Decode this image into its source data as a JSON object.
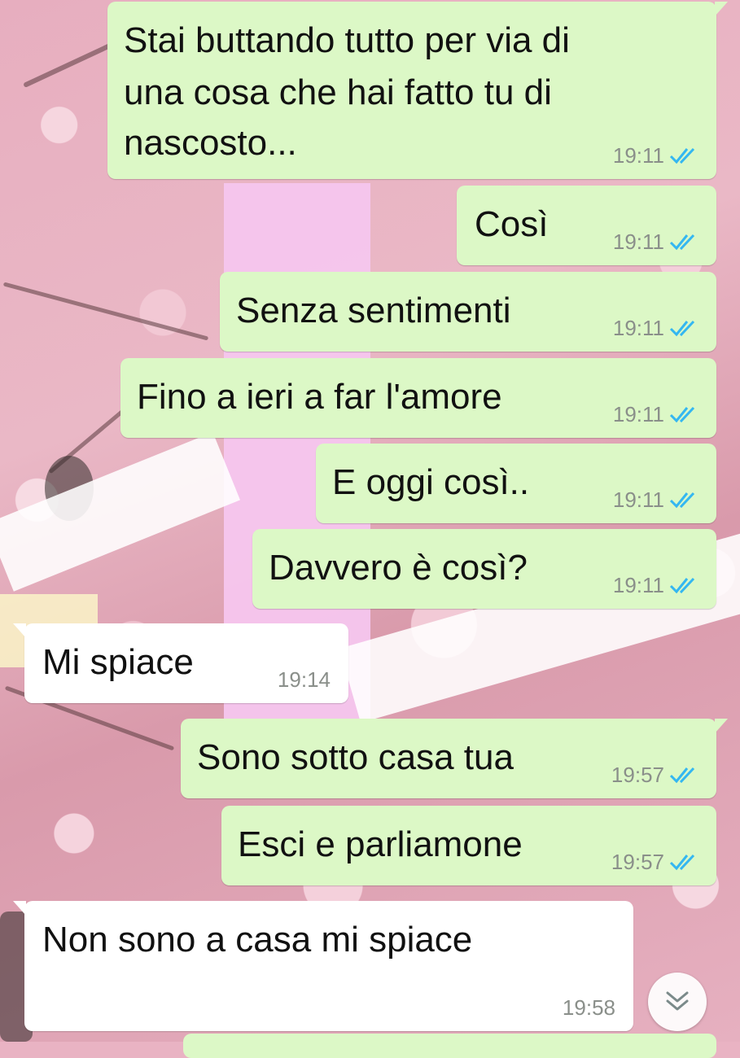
{
  "messages": [
    {
      "text_lines": [
        "Stai buttando tutto per via di",
        "una cosa che hai fatto tu di",
        "nascosto..."
      ],
      "time": "19:11",
      "direction": "out",
      "status": "read"
    },
    {
      "text": "Così",
      "time": "19:11",
      "direction": "out",
      "status": "read"
    },
    {
      "text": "Senza sentimenti",
      "time": "19:11",
      "direction": "out",
      "status": "read"
    },
    {
      "text": "Fino a ieri a far l'amore",
      "time": "19:11",
      "direction": "out",
      "status": "read"
    },
    {
      "text": "E oggi così..",
      "time": "19:11",
      "direction": "out",
      "status": "read"
    },
    {
      "text": "Davvero è così?",
      "time": "19:11",
      "direction": "out",
      "status": "read"
    },
    {
      "text": "Mi spiace",
      "time": "19:14",
      "direction": "in"
    },
    {
      "text": "Sono sotto casa tua",
      "time": "19:57",
      "direction": "out",
      "status": "read"
    },
    {
      "text": "Esci e parliamone",
      "time": "19:57",
      "direction": "out",
      "status": "read"
    },
    {
      "text": "Non sono a casa mi spiace",
      "time": "19:58",
      "direction": "in"
    }
  ],
  "icons": {
    "read_receipt": "double-check-icon",
    "scroll_down": "chevron-double-down-icon"
  },
  "colors": {
    "outgoing_bubble": "#dcf8c6",
    "incoming_bubble": "#ffffff",
    "read_tick": "#34b7f1",
    "timestamp": "#8a8f8a"
  }
}
